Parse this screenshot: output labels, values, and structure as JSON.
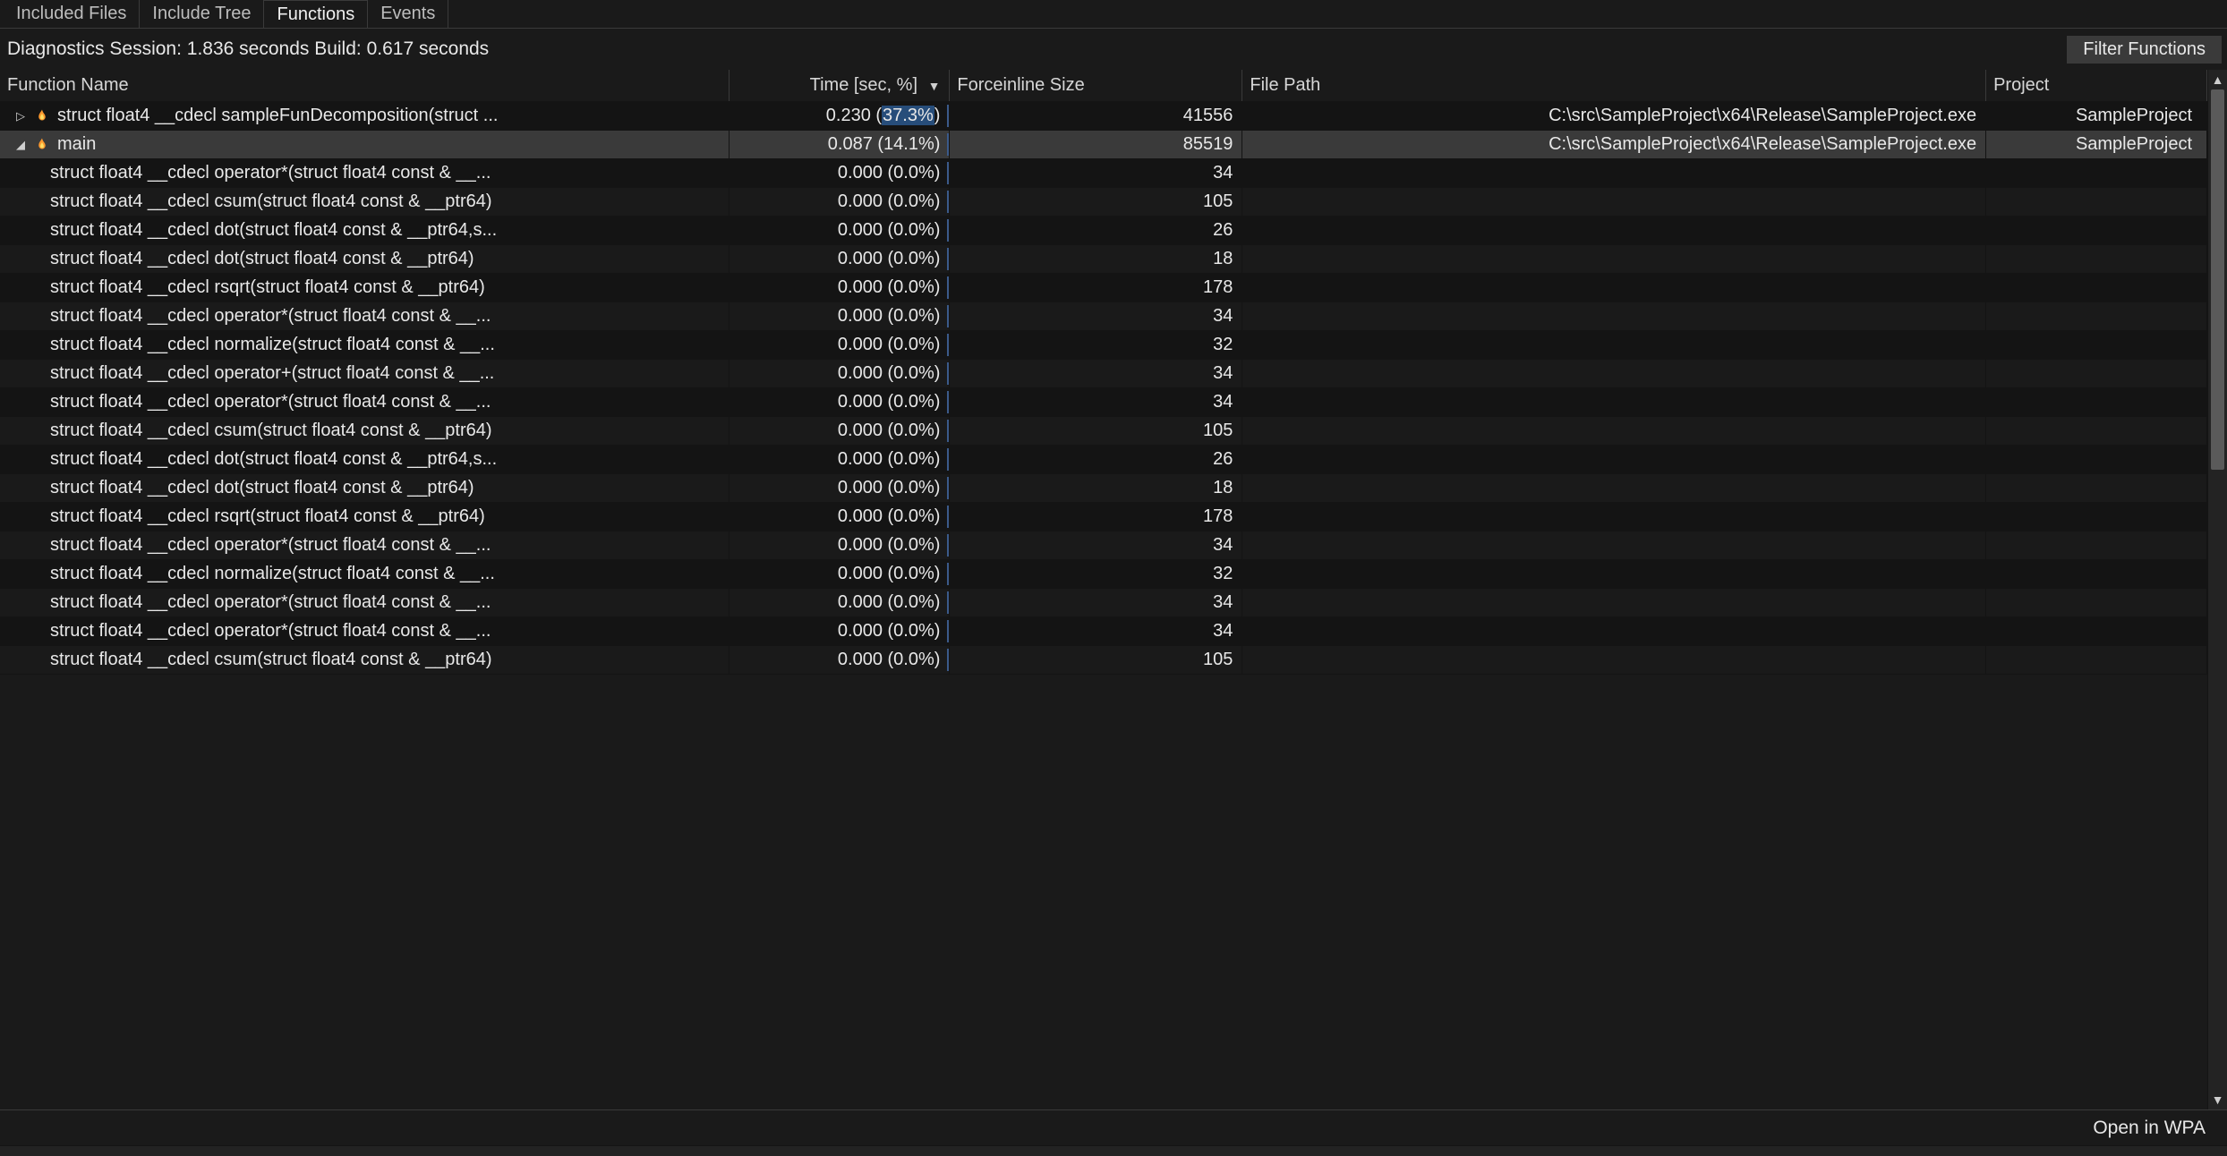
{
  "tabs": [
    {
      "label": "Included Files",
      "active": false
    },
    {
      "label": "Include Tree",
      "active": false
    },
    {
      "label": "Functions",
      "active": true
    },
    {
      "label": "Events",
      "active": false
    }
  ],
  "session": {
    "diag_prefix": "Diagnostics Session: ",
    "diag_value": "1.836 seconds",
    "build_prefix": "  Build: ",
    "build_value": "0.617 seconds"
  },
  "filter_button": "Filter Functions",
  "columns": {
    "name": "Function Name",
    "time": "Time [sec, %]",
    "size": "Forceinline Size",
    "path": "File Path",
    "project": "Project"
  },
  "rows": [
    {
      "level": 0,
      "caret": "right",
      "flame": true,
      "name": "struct float4 __cdecl sampleFunDecomposition(struct ...",
      "time_pre": "0.230 (",
      "time_pct": "37.3%",
      "time_post": ")",
      "highlight": true,
      "size": "41556",
      "path": "C:\\src\\SampleProject\\x64\\Release\\SampleProject.exe",
      "project": "SampleProject",
      "selected": false
    },
    {
      "level": 0,
      "caret": "down",
      "flame": true,
      "name": "main",
      "time_pre": "0.087 (14.1%)",
      "time_pct": "",
      "time_post": "",
      "highlight": false,
      "size": "85519",
      "path": "C:\\src\\SampleProject\\x64\\Release\\SampleProject.exe",
      "project": "SampleProject",
      "selected": true
    },
    {
      "level": 1,
      "caret": "",
      "flame": false,
      "name": "struct float4 __cdecl operator*(struct float4 const & __...",
      "time_pre": "0.000 (0.0%)",
      "time_pct": "",
      "time_post": "",
      "highlight": false,
      "size": "34",
      "path": "",
      "project": "",
      "selected": false
    },
    {
      "level": 1,
      "caret": "",
      "flame": false,
      "name": "struct float4 __cdecl csum(struct float4 const & __ptr64)",
      "time_pre": "0.000 (0.0%)",
      "time_pct": "",
      "time_post": "",
      "highlight": false,
      "size": "105",
      "path": "",
      "project": "",
      "selected": false
    },
    {
      "level": 1,
      "caret": "",
      "flame": false,
      "name": "struct float4 __cdecl dot(struct float4 const & __ptr64,s...",
      "time_pre": "0.000 (0.0%)",
      "time_pct": "",
      "time_post": "",
      "highlight": false,
      "size": "26",
      "path": "",
      "project": "",
      "selected": false
    },
    {
      "level": 1,
      "caret": "",
      "flame": false,
      "name": "struct float4 __cdecl dot(struct float4 const & __ptr64)",
      "time_pre": "0.000 (0.0%)",
      "time_pct": "",
      "time_post": "",
      "highlight": false,
      "size": "18",
      "path": "",
      "project": "",
      "selected": false
    },
    {
      "level": 1,
      "caret": "",
      "flame": false,
      "name": "struct float4 __cdecl rsqrt(struct float4 const & __ptr64)",
      "time_pre": "0.000 (0.0%)",
      "time_pct": "",
      "time_post": "",
      "highlight": false,
      "size": "178",
      "path": "",
      "project": "",
      "selected": false
    },
    {
      "level": 1,
      "caret": "",
      "flame": false,
      "name": "struct float4 __cdecl operator*(struct float4 const & __...",
      "time_pre": "0.000 (0.0%)",
      "time_pct": "",
      "time_post": "",
      "highlight": false,
      "size": "34",
      "path": "",
      "project": "",
      "selected": false
    },
    {
      "level": 1,
      "caret": "",
      "flame": false,
      "name": "struct float4 __cdecl normalize(struct float4 const & __...",
      "time_pre": "0.000 (0.0%)",
      "time_pct": "",
      "time_post": "",
      "highlight": false,
      "size": "32",
      "path": "",
      "project": "",
      "selected": false
    },
    {
      "level": 1,
      "caret": "",
      "flame": false,
      "name": "struct float4 __cdecl operator+(struct float4 const & __...",
      "time_pre": "0.000 (0.0%)",
      "time_pct": "",
      "time_post": "",
      "highlight": false,
      "size": "34",
      "path": "",
      "project": "",
      "selected": false
    },
    {
      "level": 1,
      "caret": "",
      "flame": false,
      "name": "struct float4 __cdecl operator*(struct float4 const & __...",
      "time_pre": "0.000 (0.0%)",
      "time_pct": "",
      "time_post": "",
      "highlight": false,
      "size": "34",
      "path": "",
      "project": "",
      "selected": false
    },
    {
      "level": 1,
      "caret": "",
      "flame": false,
      "name": "struct float4 __cdecl csum(struct float4 const & __ptr64)",
      "time_pre": "0.000 (0.0%)",
      "time_pct": "",
      "time_post": "",
      "highlight": false,
      "size": "105",
      "path": "",
      "project": "",
      "selected": false
    },
    {
      "level": 1,
      "caret": "",
      "flame": false,
      "name": "struct float4 __cdecl dot(struct float4 const & __ptr64,s...",
      "time_pre": "0.000 (0.0%)",
      "time_pct": "",
      "time_post": "",
      "highlight": false,
      "size": "26",
      "path": "",
      "project": "",
      "selected": false
    },
    {
      "level": 1,
      "caret": "",
      "flame": false,
      "name": "struct float4 __cdecl dot(struct float4 const & __ptr64)",
      "time_pre": "0.000 (0.0%)",
      "time_pct": "",
      "time_post": "",
      "highlight": false,
      "size": "18",
      "path": "",
      "project": "",
      "selected": false
    },
    {
      "level": 1,
      "caret": "",
      "flame": false,
      "name": "struct float4 __cdecl rsqrt(struct float4 const & __ptr64)",
      "time_pre": "0.000 (0.0%)",
      "time_pct": "",
      "time_post": "",
      "highlight": false,
      "size": "178",
      "path": "",
      "project": "",
      "selected": false
    },
    {
      "level": 1,
      "caret": "",
      "flame": false,
      "name": "struct float4 __cdecl operator*(struct float4 const & __...",
      "time_pre": "0.000 (0.0%)",
      "time_pct": "",
      "time_post": "",
      "highlight": false,
      "size": "34",
      "path": "",
      "project": "",
      "selected": false
    },
    {
      "level": 1,
      "caret": "",
      "flame": false,
      "name": "struct float4 __cdecl normalize(struct float4 const & __...",
      "time_pre": "0.000 (0.0%)",
      "time_pct": "",
      "time_post": "",
      "highlight": false,
      "size": "32",
      "path": "",
      "project": "",
      "selected": false
    },
    {
      "level": 1,
      "caret": "",
      "flame": false,
      "name": "struct float4 __cdecl operator*(struct float4 const & __...",
      "time_pre": "0.000 (0.0%)",
      "time_pct": "",
      "time_post": "",
      "highlight": false,
      "size": "34",
      "path": "",
      "project": "",
      "selected": false
    },
    {
      "level": 1,
      "caret": "",
      "flame": false,
      "name": "struct float4 __cdecl operator*(struct float4 const & __...",
      "time_pre": "0.000 (0.0%)",
      "time_pct": "",
      "time_post": "",
      "highlight": false,
      "size": "34",
      "path": "",
      "project": "",
      "selected": false
    },
    {
      "level": 1,
      "caret": "",
      "flame": false,
      "name": "struct float4 __cdecl csum(struct float4 const & __ptr64)",
      "time_pre": "0.000 (0.0%)",
      "time_pct": "",
      "time_post": "",
      "highlight": false,
      "size": "105",
      "path": "",
      "project": "",
      "selected": false
    }
  ],
  "footer": {
    "open_wpa": "Open in WPA"
  }
}
